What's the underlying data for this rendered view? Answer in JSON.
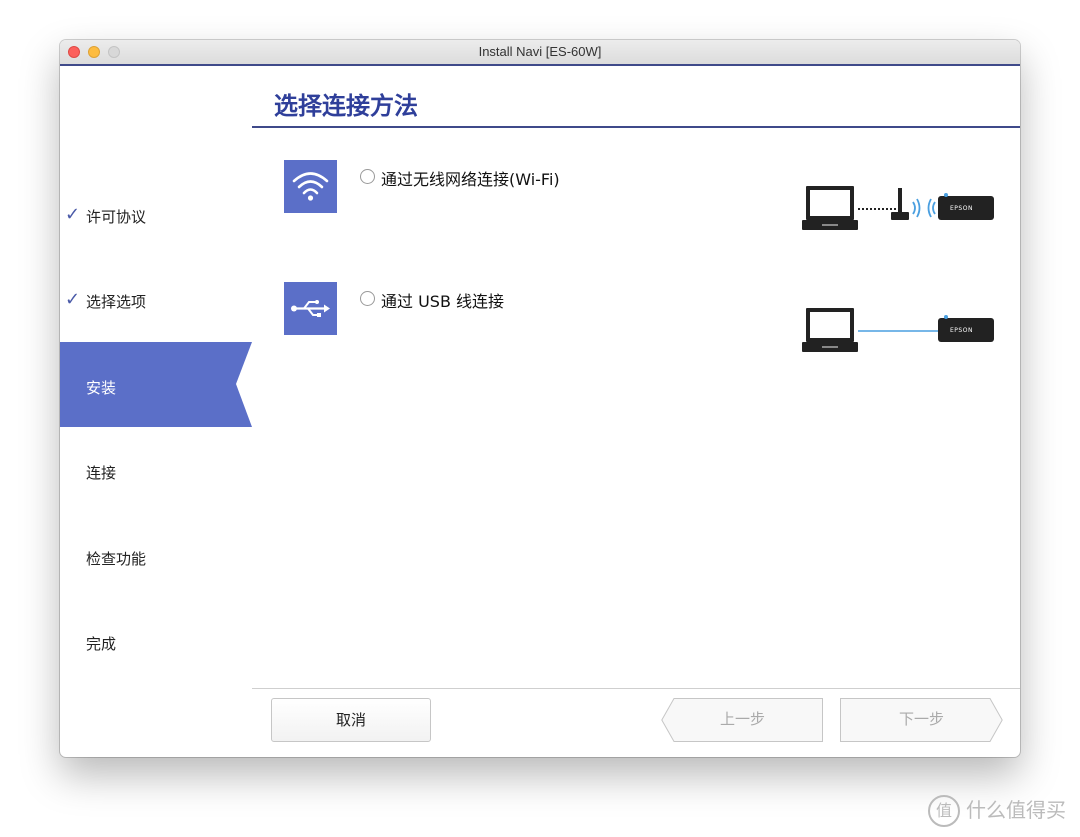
{
  "window": {
    "title": "Install Navi [ES-60W]"
  },
  "sidebar": {
    "steps": [
      {
        "label": "许可协议",
        "done": true
      },
      {
        "label": "选择选项",
        "done": true
      },
      {
        "label": "安装",
        "active": true
      },
      {
        "label": "连接"
      },
      {
        "label": "检查功能"
      },
      {
        "label": "完成"
      }
    ]
  },
  "main": {
    "title": "选择连接方法",
    "options": [
      {
        "label": "通过无线网络连接(Wi-Fi)",
        "icon": "wifi-icon",
        "selected": false
      },
      {
        "label": "通过 USB 线连接",
        "icon": "usb-icon",
        "selected": false
      }
    ],
    "device_label": "EPSON"
  },
  "footer": {
    "cancel": "取消",
    "prev": "上一步",
    "next": "下一步"
  },
  "watermark": {
    "text": "什么值得买",
    "logo": "值"
  },
  "colors": {
    "accent": "#5b6fc8",
    "title": "#2f3f9a",
    "rule": "#3f4a8a",
    "wifi_signal": "#4a9fe0",
    "usb_cable": "#4a9fe0"
  }
}
